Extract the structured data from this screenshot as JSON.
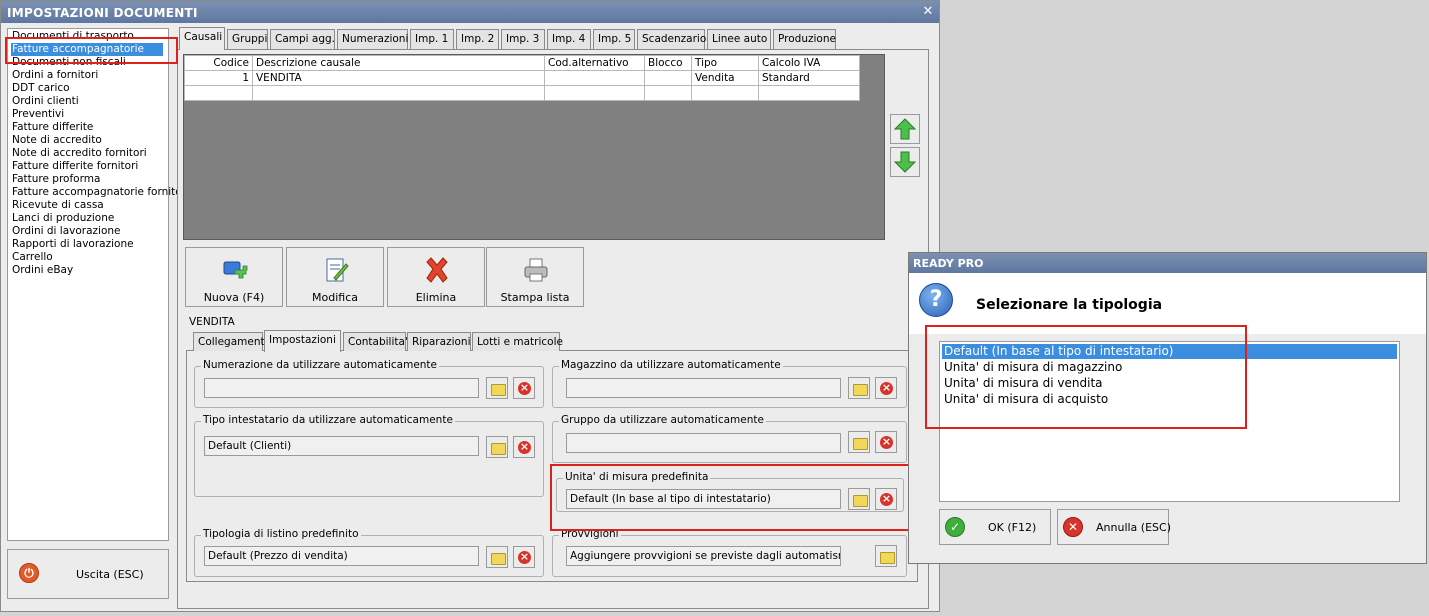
{
  "window": {
    "title": "IMPOSTAZIONI DOCUMENTI",
    "close_glyph": "✕"
  },
  "doc_list": {
    "selected_index": 1,
    "items": [
      "Documenti di trasporto",
      "Fatture accompagnatorie",
      "Documenti non fiscali",
      "Ordini a fornitori",
      "DDT carico",
      "Ordini clienti",
      "Preventivi",
      "Fatture differite",
      "Note di accredito",
      "Note di accredito fornitori",
      "Fatture differite fornitori",
      "Fatture proforma",
      "Fatture accompagnatorie fornito",
      "Ricevute di cassa",
      "Lanci di produzione",
      "Ordini di lavorazione",
      "Rapporti di lavorazione",
      "Carrello",
      "Ordini eBay"
    ]
  },
  "exit_button": {
    "label": "Uscita (ESC)",
    "icon": "power-icon"
  },
  "tabs": [
    "Causali",
    "Gruppi",
    "Campi agg.",
    "Numerazioni",
    "Imp. 1",
    "Imp. 2",
    "Imp. 3",
    "Imp. 4",
    "Imp. 5",
    "Scadenzario",
    "Linee auto",
    "Produzione"
  ],
  "grid": {
    "columns": [
      "Codice",
      "Descrizione causale",
      "Cod.alternativo",
      "Blocco",
      "Tipo",
      "Calcolo IVA"
    ],
    "rows": [
      [
        "1",
        "VENDITA",
        "",
        "",
        "Vendita",
        "Standard"
      ],
      [
        "",
        "",
        "",
        "",
        "",
        ""
      ]
    ]
  },
  "move_buttons": {
    "up_icon": "arrow-up-icon",
    "down_icon": "arrow-down-icon"
  },
  "toolbar": {
    "new_label": "Nuova (F4)",
    "edit_label": "Modifica",
    "delete_label": "Elimina",
    "print_label": "Stampa lista"
  },
  "causale": {
    "group_label": "VENDITA",
    "subtabs": [
      "Collegamenti",
      "Impostazioni",
      "Contabilita'",
      "Riparazioni",
      "Lotti e matricole"
    ],
    "fields": {
      "numerazione": {
        "label": "Numerazione da utilizzare automaticamente",
        "value": ""
      },
      "magazzino": {
        "label": "Magazzino da utilizzare automaticamente",
        "value": ""
      },
      "tipo_intestatario": {
        "label": "Tipo intestatario da utilizzare automaticamente",
        "value": "Default (Clienti)"
      },
      "gruppo": {
        "label": "Gruppo da utilizzare automaticamente",
        "value": ""
      },
      "unita_misura": {
        "label": "Unita' di misura predefinita",
        "value": "Default (In base al tipo di intestatario)"
      },
      "listino": {
        "label": "Tipologia di listino predefinito",
        "value": "Default (Prezzo di vendita)"
      },
      "provvigioni": {
        "label": "Provvigioni",
        "value": "Aggiungere provvigioni se previste dagli automatismi"
      }
    }
  },
  "dialog": {
    "title": "READY PRO",
    "heading": "Selezionare la tipologia",
    "selected_index": 0,
    "options": [
      "Default (In base al tipo di intestatario)",
      "Unita' di misura di magazzino",
      "Unita' di misura di vendita",
      "Unita' di misura di acquisto"
    ],
    "ok_label": "OK (F12)",
    "cancel_label": "Annulla (ESC)"
  },
  "colors": {
    "title_bar": "#6a82aa",
    "selection": "#3b8de0",
    "highlight_box": "#e0201a"
  }
}
